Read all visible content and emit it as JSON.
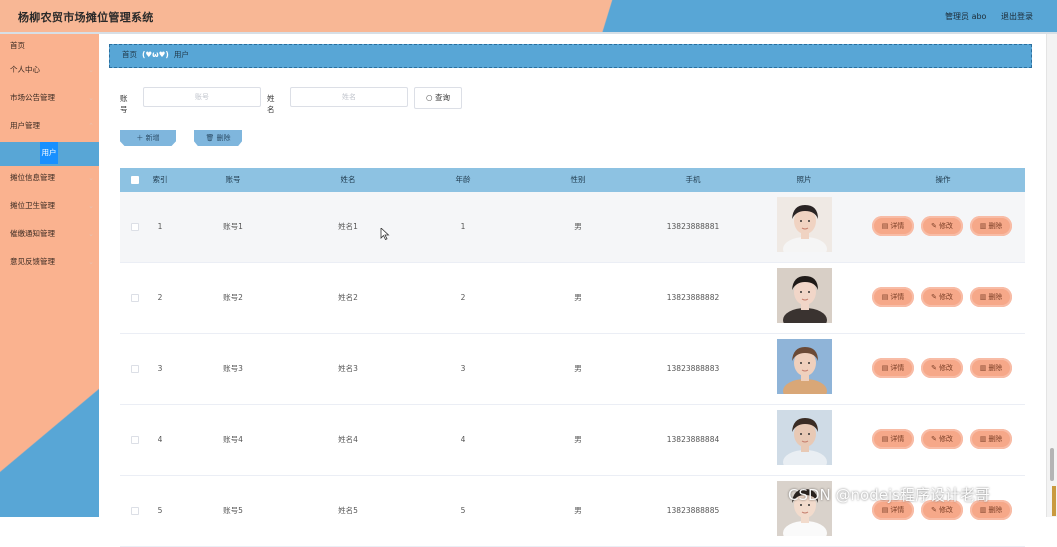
{
  "header": {
    "title": "杨柳农贸市场摊位管理系统",
    "user_label": "管理员 abo",
    "logout_label": "退出登录"
  },
  "sidebar": {
    "items": [
      {
        "label": "首页",
        "has_children": false
      },
      {
        "label": "个人中心",
        "has_children": true
      },
      {
        "label": "市场公告管理",
        "has_children": true
      },
      {
        "label": "用户管理",
        "has_children": true
      },
      {
        "label": "摊位信息管理",
        "has_children": true
      },
      {
        "label": "摊位卫生管理",
        "has_children": true
      },
      {
        "label": "催缴通知管理",
        "has_children": true
      },
      {
        "label": "意见反馈管理",
        "has_children": true
      }
    ],
    "active_sub": "用户"
  },
  "breadcrumb": {
    "home": "首页",
    "separator": "(♥ω♥)",
    "current": "用户"
  },
  "search": {
    "account_label": "账号",
    "account_placeholder": "账号",
    "name_label": "姓名",
    "name_placeholder": "姓名",
    "query_label": "查询"
  },
  "actions": {
    "add_label": "新增",
    "delete_label": "删除"
  },
  "table": {
    "headers": [
      "索引",
      "账号",
      "姓名",
      "年龄",
      "性别",
      "手机",
      "照片",
      "操作"
    ],
    "rows": [
      {
        "index": "1",
        "account": "账号1",
        "name": "姓名1",
        "age": "1",
        "gender": "男",
        "phone": "13823888881"
      },
      {
        "index": "2",
        "account": "账号2",
        "name": "姓名2",
        "age": "2",
        "gender": "男",
        "phone": "13823888882"
      },
      {
        "index": "3",
        "account": "账号3",
        "name": "姓名3",
        "age": "3",
        "gender": "男",
        "phone": "13823888883"
      },
      {
        "index": "4",
        "account": "账号4",
        "name": "姓名4",
        "age": "4",
        "gender": "男",
        "phone": "13823888884"
      },
      {
        "index": "5",
        "account": "账号5",
        "name": "姓名5",
        "age": "5",
        "gender": "男",
        "phone": "13823888885"
      }
    ],
    "op_labels": {
      "detail": "详情",
      "edit": "修改",
      "delete": "删除"
    }
  },
  "watermark": "CSDN @nodejs程序设计老哥",
  "colors": {
    "peach": "#f8b795",
    "blue": "#58a6d6",
    "active_blue": "#1890ff",
    "table_header": "#8dc2e2",
    "op_button": "#f6a889"
  }
}
